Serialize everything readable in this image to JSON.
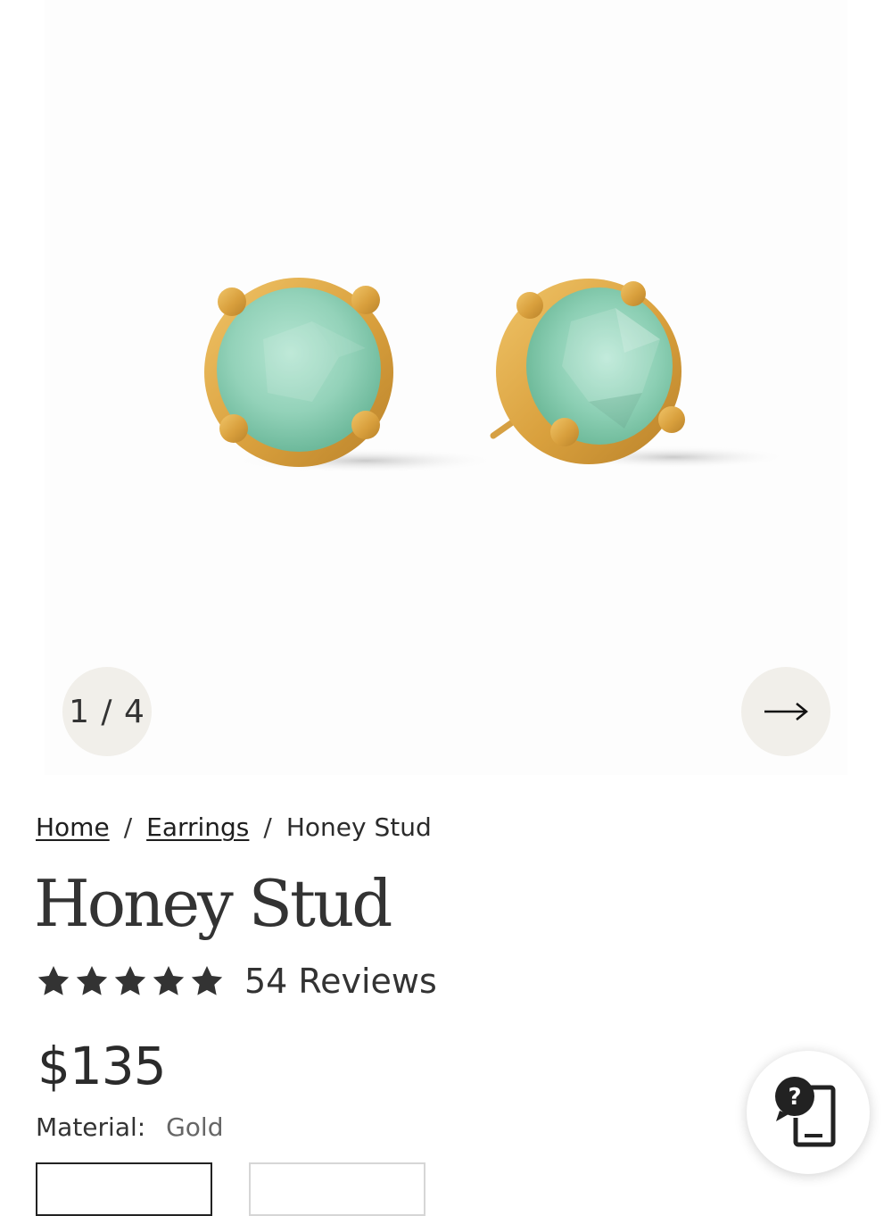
{
  "gallery": {
    "counter": "1 / 4",
    "image_alt": "Honey Stud earrings",
    "next_icon": "arrow-right-icon"
  },
  "breadcrumb": {
    "home": "Home",
    "separator": "/",
    "category": "Earrings",
    "current": "Honey Stud"
  },
  "product": {
    "title": "Honey Stud",
    "rating": 5,
    "rating_max": 5,
    "reviews_label": "54 Reviews",
    "price": "$135",
    "material_label": "Material:",
    "material_value": "Gold"
  },
  "help": {
    "icon": "help-question-icon"
  },
  "colors": {
    "gold": "#d9a441",
    "gem": "#8fd0b6",
    "button_bg": "#f1efea",
    "text": "#2b2b2b"
  }
}
